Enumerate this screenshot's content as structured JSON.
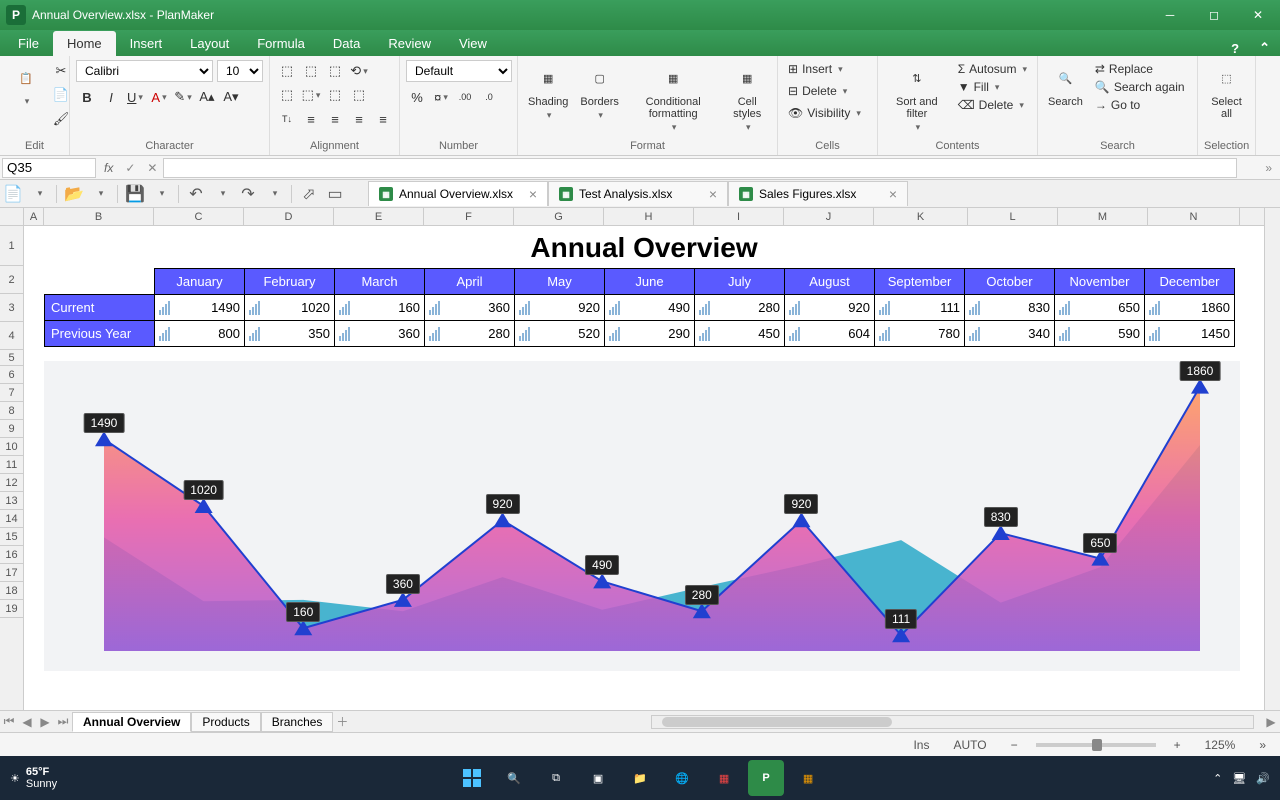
{
  "app": {
    "title": "Annual Overview.xlsx - PlanMaker",
    "icon_letter": "P"
  },
  "menu": {
    "tabs": [
      "File",
      "Home",
      "Insert",
      "Layout",
      "Formula",
      "Data",
      "Review",
      "View"
    ],
    "active": "Home"
  },
  "ribbon": {
    "edit": "Edit",
    "character": {
      "label": "Character",
      "font": "Calibri",
      "size": "10"
    },
    "alignment": "Alignment",
    "number": {
      "label": "Number",
      "format": "Default"
    },
    "format": {
      "label": "Format",
      "shading": "Shading",
      "borders": "Borders",
      "conditional": "Conditional formatting",
      "cellstyles": "Cell styles"
    },
    "cells": {
      "label": "Cells",
      "insert": "Insert",
      "delete": "Delete",
      "visibility": "Visibility"
    },
    "contents": {
      "label": "Contents",
      "sort": "Sort and filter",
      "autosum": "Autosum",
      "fill": "Fill",
      "delete": "Delete"
    },
    "search": {
      "label": "Search",
      "search": "Search",
      "replace": "Replace",
      "again": "Search again",
      "goto": "Go to"
    },
    "selection": {
      "label": "Selection",
      "selectall": "Select all"
    }
  },
  "formula": {
    "cellref": "Q35"
  },
  "doctabs": [
    {
      "name": "Annual Overview.xlsx",
      "active": true
    },
    {
      "name": "Test Analysis.xlsx",
      "active": false
    },
    {
      "name": "Sales Figures.xlsx",
      "active": false
    }
  ],
  "columns": [
    "A",
    "B",
    "C",
    "D",
    "E",
    "F",
    "G",
    "H",
    "I",
    "J",
    "K",
    "L",
    "M",
    "N"
  ],
  "rows": [
    "1",
    "2",
    "3",
    "4",
    "5",
    "6",
    "7",
    "8",
    "9",
    "10",
    "11",
    "12",
    "13",
    "14",
    "15",
    "16",
    "17",
    "18",
    "19"
  ],
  "table": {
    "title": "Annual Overview",
    "months": [
      "January",
      "February",
      "March",
      "April",
      "May",
      "June",
      "July",
      "August",
      "September",
      "October",
      "November",
      "December"
    ],
    "rows": [
      {
        "label": "Current",
        "values": [
          1490,
          1020,
          160,
          360,
          920,
          490,
          280,
          920,
          111,
          830,
          650,
          1860
        ]
      },
      {
        "label": "Previous Year",
        "values": [
          800,
          350,
          360,
          280,
          520,
          290,
          450,
          604,
          780,
          340,
          590,
          1450
        ]
      }
    ]
  },
  "chart_data": {
    "type": "area",
    "categories": [
      "January",
      "February",
      "March",
      "April",
      "May",
      "June",
      "July",
      "August",
      "September",
      "October",
      "November",
      "December"
    ],
    "series": [
      {
        "name": "Current",
        "values": [
          1490,
          1020,
          160,
          360,
          920,
          490,
          280,
          920,
          111,
          830,
          650,
          1860
        ]
      },
      {
        "name": "Previous Year",
        "values": [
          800,
          350,
          360,
          280,
          520,
          290,
          450,
          604,
          780,
          340,
          590,
          1450
        ]
      }
    ],
    "title": "Annual Overview",
    "ylim": [
      0,
      1900
    ],
    "data_labels_series": "Current"
  },
  "sheettabs": {
    "tabs": [
      "Annual Overview",
      "Products",
      "Branches"
    ],
    "active": "Annual Overview"
  },
  "status": {
    "ins": "Ins",
    "auto": "AUTO",
    "zoom": "125%",
    "minus": "−",
    "plus": "+"
  },
  "taskbar": {
    "temp": "65°F",
    "cond": "Sunny"
  }
}
